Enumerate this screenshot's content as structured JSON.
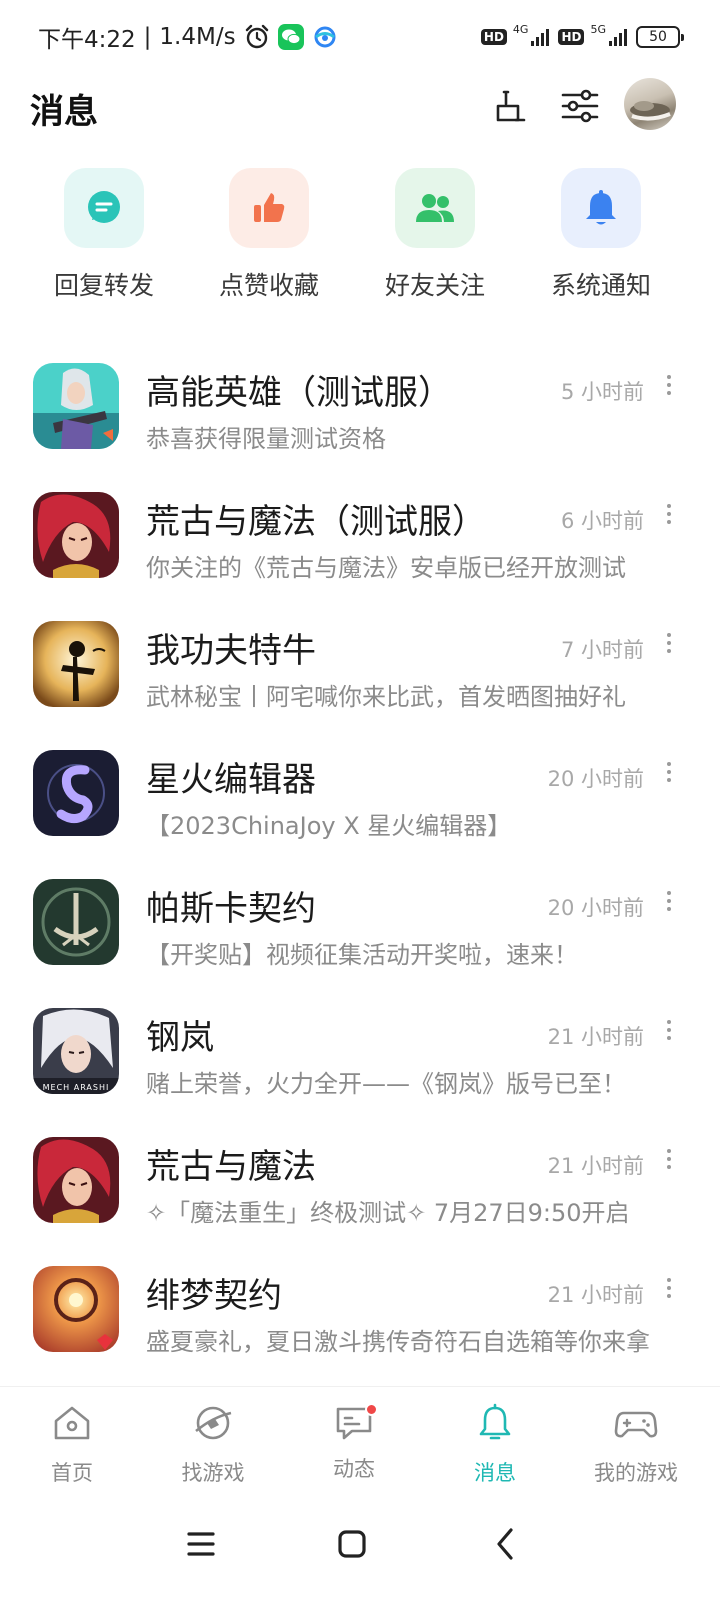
{
  "status_bar": {
    "time": "下午4:22",
    "separator": "|",
    "speed": "1.4M/s",
    "alarm_icon": "alarm-icon",
    "hd1": "HD",
    "net1": "4G",
    "hd2": "HD",
    "net2": "5G",
    "battery": "50"
  },
  "header": {
    "title": "消息",
    "clean_icon": "broom-icon",
    "filter_icon": "sliders-icon",
    "avatar_icon": "user-avatar"
  },
  "quick_actions": [
    {
      "label": "回复转发",
      "icon": "chat-bubble-icon",
      "bg": "#e4f7f5",
      "color": "#2ac4b8"
    },
    {
      "label": "点赞收藏",
      "icon": "thumbs-up-icon",
      "bg": "#fdece6",
      "color": "#f2734d"
    },
    {
      "label": "好友关注",
      "icon": "friends-icon",
      "bg": "#e5f6ea",
      "color": "#34c06a"
    },
    {
      "label": "系统通知",
      "icon": "bell-icon",
      "bg": "#e8effd",
      "color": "#3b82f0"
    }
  ],
  "messages": [
    {
      "title": "高能英雄（测试服）",
      "subtitle": "恭喜获得限量测试资格",
      "time": "5 小时前"
    },
    {
      "title": "荒古与魔法（测试服）",
      "subtitle": "你关注的《荒古与魔法》安卓版已经开放测试",
      "time": "6 小时前"
    },
    {
      "title": "我功夫特牛",
      "subtitle": "武林秘宝丨阿宅喊你来比武，首发晒图抽好礼",
      "time": "7 小时前"
    },
    {
      "title": "星火编辑器",
      "subtitle": "【2023ChinaJoy X 星火编辑器】",
      "time": "20 小时前"
    },
    {
      "title": "帕斯卡契约",
      "subtitle": "【开奖贴】视频征集活动开奖啦，速来！",
      "time": "20 小时前"
    },
    {
      "title": "钢岚",
      "subtitle": "赌上荣誉，火力全开——《钢岚》版号已至！",
      "time": "21 小时前",
      "icon_text": "MECH ARASHI"
    },
    {
      "title": "荒古与魔法",
      "subtitle": "✧「魔法重生」终极测试✧ 7月27日9:50开启",
      "time": "21 小时前"
    },
    {
      "title": "绯梦契约",
      "subtitle": "盛夏豪礼，夏日激斗携传奇符石自选箱等你来拿",
      "time": "21 小时前"
    }
  ],
  "bottom_nav": [
    {
      "label": "首页",
      "icon": "home-icon"
    },
    {
      "label": "找游戏",
      "icon": "discover-icon"
    },
    {
      "label": "动态",
      "icon": "feed-icon"
    },
    {
      "label": "消息",
      "icon": "bell-icon",
      "active": true
    },
    {
      "label": "我的游戏",
      "icon": "gamepad-icon"
    }
  ],
  "colors": {
    "accent": "#1fb8b3",
    "badge": "#f04848"
  }
}
